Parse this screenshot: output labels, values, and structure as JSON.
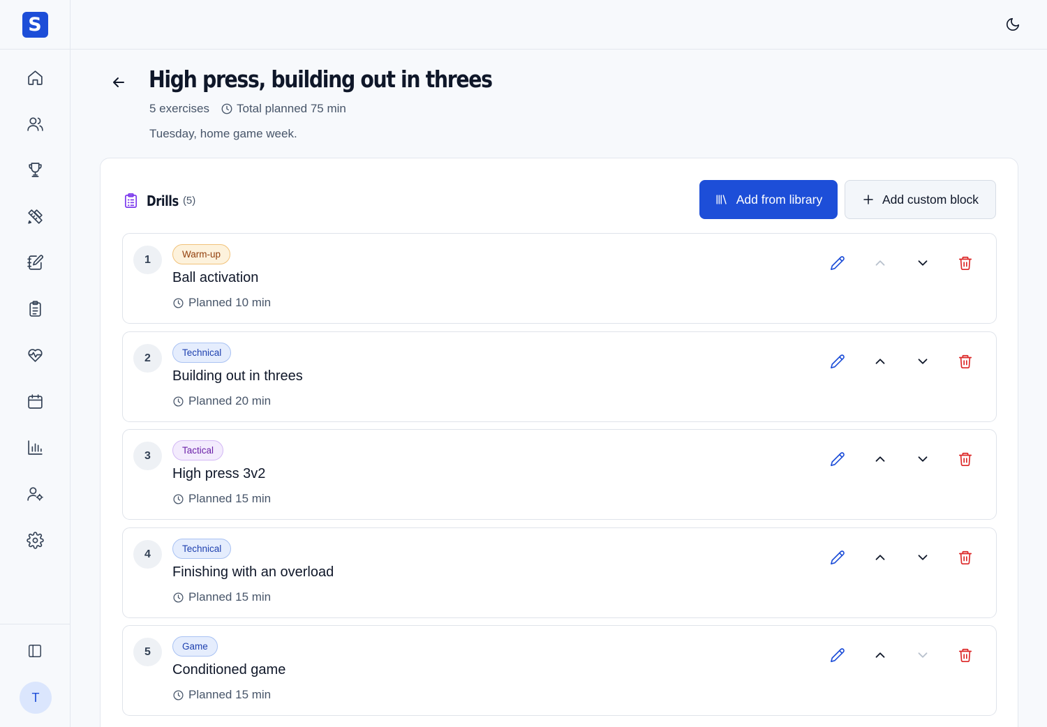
{
  "app": {
    "logo_letter": "S",
    "brand_color": "#1d4ed8"
  },
  "sidebar": {
    "items": [
      {
        "name": "home",
        "icon": "home-icon"
      },
      {
        "name": "players",
        "icon": "users-icon"
      },
      {
        "name": "competitions",
        "icon": "trophy-icon"
      },
      {
        "name": "drills",
        "icon": "pencil-ruler-icon"
      },
      {
        "name": "plans",
        "icon": "notebook-pen-icon"
      },
      {
        "name": "sessions",
        "icon": "clipboard-list-icon"
      },
      {
        "name": "health",
        "icon": "heart-pulse-icon"
      },
      {
        "name": "calendar",
        "icon": "calendar-icon"
      },
      {
        "name": "stats",
        "icon": "bar-chart-icon"
      },
      {
        "name": "staff",
        "icon": "user-cog-icon"
      },
      {
        "name": "settings",
        "icon": "gear-icon"
      }
    ],
    "collapse_icon": "panel-left-icon",
    "user_initial": "T"
  },
  "header": {
    "theme_icon": "moon-icon"
  },
  "page": {
    "title": "High press, building out in threes",
    "exercises": "5 exercises",
    "total": "Total planned 75 min",
    "note": "Tuesday, home game week."
  },
  "drills_panel": {
    "title": "Drills",
    "count": "(5)",
    "add_library": "Add from library",
    "add_custom": "Add custom block"
  },
  "drills": [
    {
      "number": "1",
      "tag": "Warm-up",
      "tag_type": "warm",
      "name": "Ball activation",
      "time": "Planned 10 min"
    },
    {
      "number": "2",
      "tag": "Technical",
      "tag_type": "technical",
      "name": "Building out in threes",
      "time": "Planned 20 min"
    },
    {
      "number": "3",
      "tag": "Tactical",
      "tag_type": "tactical",
      "name": "High press 3v2",
      "time": "Planned 15 min"
    },
    {
      "number": "4",
      "tag": "Technical",
      "tag_type": "technical",
      "name": "Finishing with an overload",
      "time": "Planned 15 min"
    },
    {
      "number": "5",
      "tag": "Game",
      "tag_type": "game",
      "name": "Conditioned game",
      "time": "Planned 15 min"
    }
  ]
}
